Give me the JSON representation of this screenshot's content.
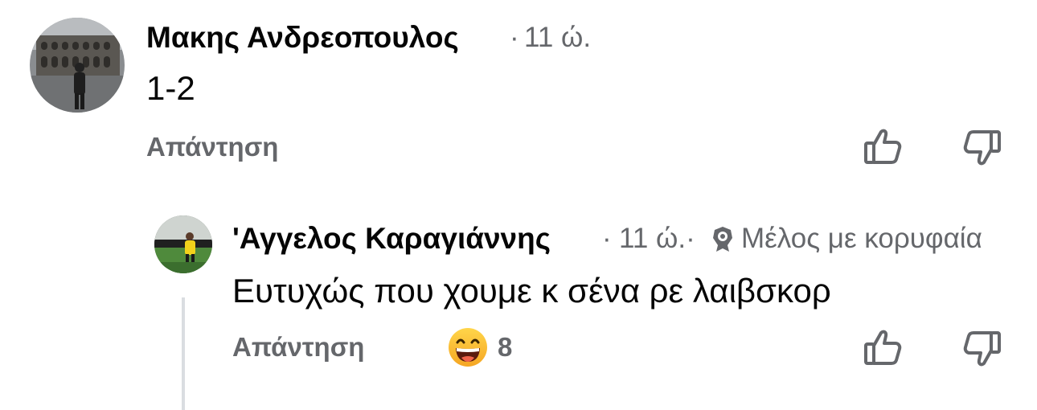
{
  "comment": {
    "author": "Μακης Ανδρεοπουλος",
    "separator": "·",
    "time": "11 ώ.",
    "text": "1-2",
    "reply_label": "Απάντηση"
  },
  "reply": {
    "author": "'Αγγελος Καραγιάννης",
    "separator": "·",
    "time": "11 ώ.·",
    "badge_label": "Μέλος με κορυφαία",
    "text": "Ευτυχώς που χουμε κ σένα ρε λαιβσκορ",
    "reply_label": "Απάντηση",
    "reaction_count": "8"
  },
  "icons": {
    "like": "thumbs-up-icon",
    "dislike": "thumbs-down-icon",
    "reaction": "grinning-sweat-emoji",
    "badge": "top-fan-badge-icon"
  },
  "colors": {
    "text_primary": "#050505",
    "text_secondary": "#65676b",
    "emoji_yellow": "#f7b125"
  }
}
